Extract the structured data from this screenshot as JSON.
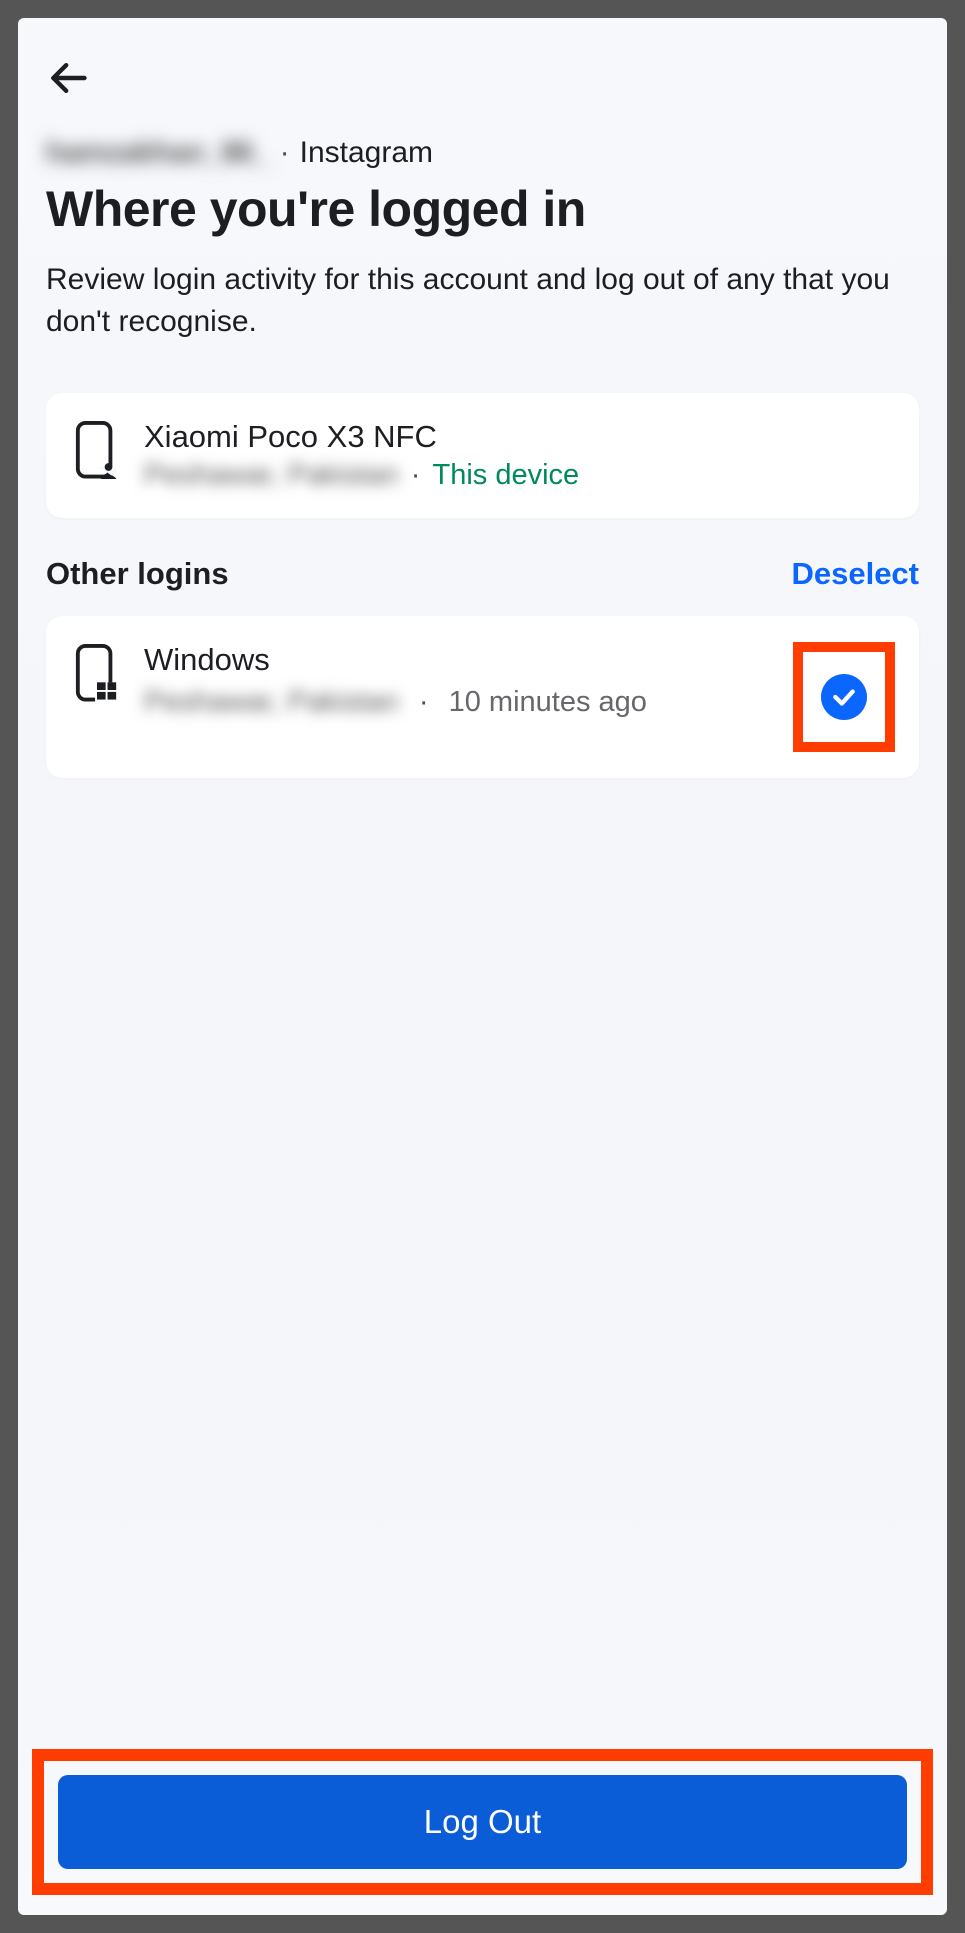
{
  "account": {
    "username_masked": "hamzakhan_86_",
    "platform": "Instagram"
  },
  "header": {
    "title": "Where you're logged in",
    "subtitle": "Review login activity for this account and log out of any that you don't recognise."
  },
  "current_device": {
    "name": "Xiaomi Poco X3 NFC",
    "location_masked": "Peshawar, Pakistan",
    "badge": "This device"
  },
  "other_section": {
    "title": "Other logins",
    "deselect_label": "Deselect"
  },
  "other_logins": [
    {
      "name": "Windows",
      "location_masked": "Peshawar, Pakistan",
      "time": "10 minutes ago",
      "selected": true
    }
  ],
  "footer": {
    "logout_label": "Log Out"
  }
}
